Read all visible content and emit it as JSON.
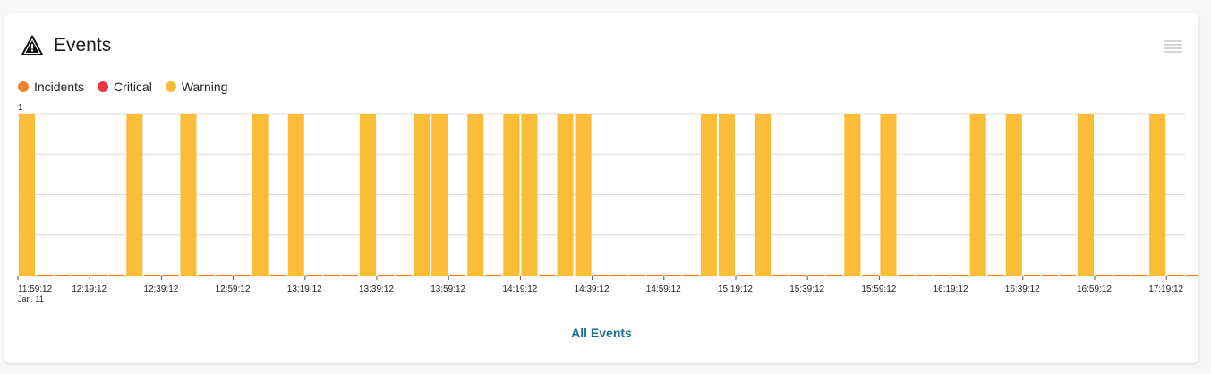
{
  "card": {
    "title": "Events",
    "title_icon": "warning-triangle-icon",
    "menu_icon": "hamburger-menu-icon",
    "footer_link": "All Events"
  },
  "colors": {
    "incidents": "#f47d30",
    "critical": "#e8383d",
    "warning": "#fbbd37",
    "link": "#1e6f8e"
  },
  "chart_data": {
    "type": "bar",
    "stacked": true,
    "title": "",
    "xlabel": "",
    "ylabel": "",
    "ylim": [
      0,
      1
    ],
    "y_ticks": [
      "1"
    ],
    "grid": true,
    "legend_position": "top-left",
    "legend": [
      "Incidents",
      "Critical",
      "Warning"
    ],
    "x_tick_labels": [
      "11:59:12",
      "12:19:12",
      "12:39:12",
      "12:59:12",
      "13:19:12",
      "13:39:12",
      "13:59:12",
      "14:19:12",
      "14:39:12",
      "14:59:12",
      "15:19:12",
      "15:39:12",
      "15:59:12",
      "16:19:12",
      "16:39:12",
      "16:59:12",
      "17:19:12"
    ],
    "x_date_label": "Jan. 11",
    "x_start": "11:59:12",
    "interval_minutes": 5,
    "series": [
      {
        "name": "Incidents",
        "values": [
          0,
          0,
          0,
          0,
          0,
          0,
          0,
          0,
          0,
          0,
          0,
          0,
          0,
          0,
          0,
          0,
          0,
          0,
          0,
          0,
          0,
          0,
          0,
          0,
          0,
          0,
          0,
          0,
          0,
          0,
          0,
          0,
          0,
          0,
          0,
          0,
          0,
          0,
          0,
          0,
          0,
          0,
          0,
          0,
          0,
          0,
          0,
          0,
          0,
          0,
          0,
          0,
          0,
          0,
          0,
          0,
          0,
          0,
          0,
          0,
          0,
          0,
          0,
          0,
          0,
          0
        ]
      },
      {
        "name": "Critical",
        "values": [
          0,
          0,
          0,
          0,
          0,
          0,
          0,
          0,
          0,
          0,
          0,
          0,
          0,
          0,
          0,
          0,
          0,
          0,
          0,
          0,
          0,
          0,
          0,
          0,
          0,
          0,
          0,
          0,
          0,
          0,
          0,
          0,
          0,
          0,
          0,
          0,
          0,
          0,
          0,
          0,
          0,
          0,
          0,
          0,
          0,
          0,
          0,
          0,
          0,
          0,
          0,
          0,
          0,
          0,
          0,
          0,
          0,
          0,
          0,
          0,
          0,
          0,
          0,
          0,
          0,
          0
        ]
      },
      {
        "name": "Warning",
        "values": [
          1,
          0,
          0,
          0,
          0,
          0,
          1,
          0,
          0,
          1,
          0,
          0,
          0,
          1,
          0,
          1,
          0,
          0,
          0,
          1,
          0,
          0,
          1,
          1,
          0,
          1,
          0,
          1,
          1,
          0,
          1,
          1,
          0,
          0,
          0,
          0,
          0,
          0,
          1,
          1,
          0,
          1,
          0,
          0,
          0,
          0,
          1,
          0,
          1,
          0,
          0,
          0,
          0,
          1,
          0,
          1,
          0,
          0,
          0,
          1,
          0,
          0,
          0,
          1,
          0,
          0
        ]
      }
    ]
  }
}
